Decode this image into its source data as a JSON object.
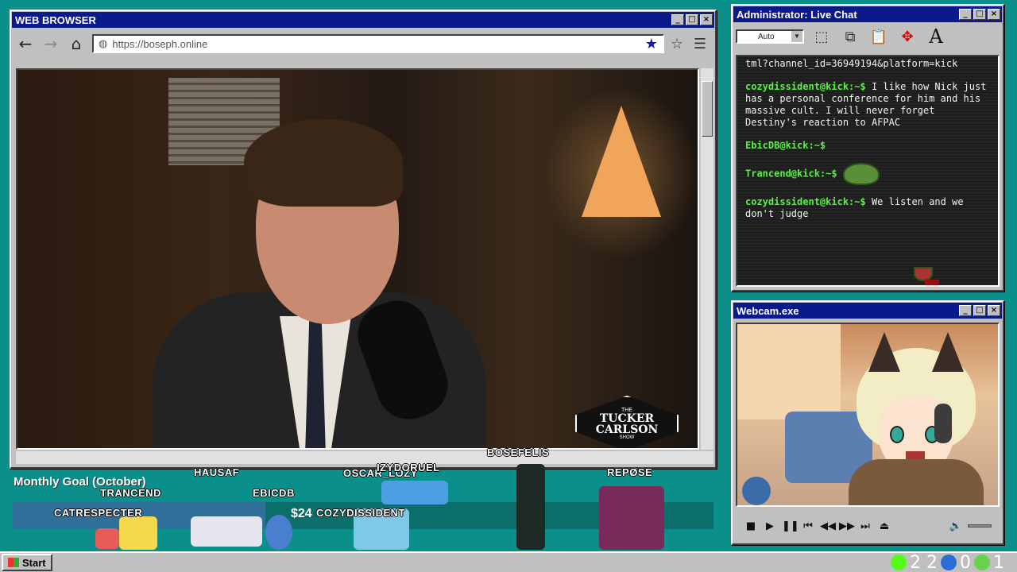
{
  "browser": {
    "title": "WEB BROWSER",
    "url": "https://boseph.online",
    "nav": {
      "back": "🡐",
      "forward": "🡒",
      "home": "⌂"
    },
    "video_logo": {
      "line1": "THE",
      "line2a": "TUCKER",
      "line2b": "CARLSON",
      "line3": "SHOW"
    }
  },
  "chat": {
    "title": "Administrator: Live Chat",
    "zoom_value": "Auto",
    "messages": [
      {
        "user": "",
        "text": "tml?channel_id=36949194&platform=kick"
      },
      {
        "user": "cozydissident@kick:~$",
        "text": "I like how Nick just has a personal conference for him and his massive cult. I will never forget Destiny's reaction to AFPAC"
      },
      {
        "user": "EbicDB@kick:~$",
        "text": "",
        "emote": "pepe-scream-emote"
      },
      {
        "user": "Trancend@kick:~$",
        "text": "",
        "emote": "pepe-frog-emote"
      },
      {
        "user": "cozydissident@kick:~$",
        "text": "We listen and we don't judge"
      }
    ]
  },
  "webcam": {
    "title": "Webcam.exe"
  },
  "goal": {
    "label": "Monthly Goal (October)",
    "amount_text": "$24",
    "progress_fraction": 0.36
  },
  "viewers": [
    "CATRESPECTER",
    "TRANCEND",
    "HAUSAF",
    "EBICDB",
    "OSCAR_LOZY",
    "IZYDORUEL",
    "COZYDISSIDENT",
    "BOSEFELIS",
    "REPØSE"
  ],
  "taskbar": {
    "start_label": "Start",
    "tray": {
      "kick_count": "2 2",
      "moon_count": "0",
      "play_count": "1"
    }
  },
  "colors": {
    "desktop": "#0b8f8a",
    "titlebar": "#0a1a8a",
    "chat_user": "#5cf047",
    "bookmark_star": "#1a1aa8"
  }
}
